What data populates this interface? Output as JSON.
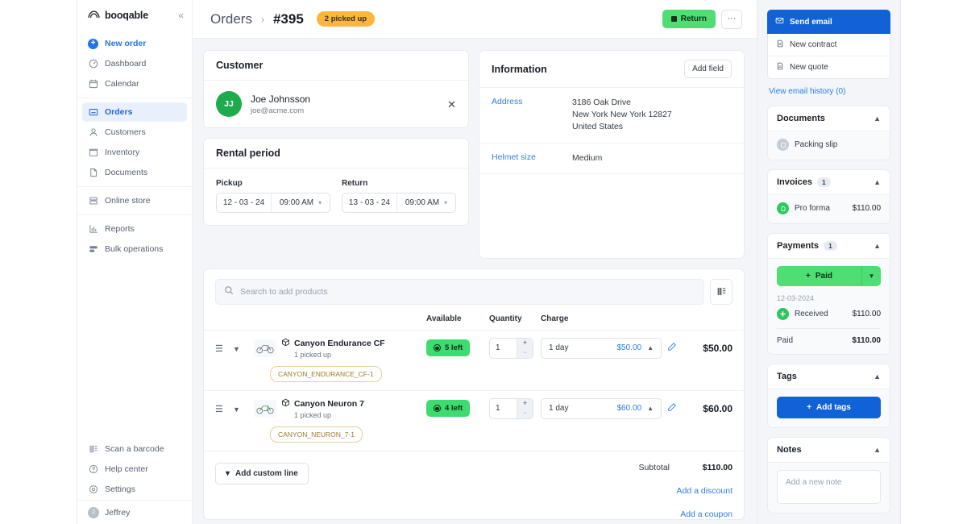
{
  "brand": {
    "name": "booqable",
    "collapse_icon": "chevrons-left-icon"
  },
  "sidebar": {
    "groups": [
      {
        "items": [
          {
            "label": "New order",
            "icon": "plus-circle-icon",
            "style": "primary"
          },
          {
            "label": "Dashboard",
            "icon": "dashboard-icon"
          },
          {
            "label": "Calendar",
            "icon": "calendar-icon"
          }
        ]
      },
      {
        "items": [
          {
            "label": "Orders",
            "icon": "orders-icon",
            "active": true
          },
          {
            "label": "Customers",
            "icon": "user-icon"
          },
          {
            "label": "Inventory",
            "icon": "inventory-icon"
          },
          {
            "label": "Documents",
            "icon": "document-icon"
          }
        ]
      },
      {
        "items": [
          {
            "label": "Online store",
            "icon": "store-icon"
          }
        ]
      },
      {
        "items": [
          {
            "label": "Reports",
            "icon": "reports-icon"
          },
          {
            "label": "Bulk operations",
            "icon": "bulk-operations-icon"
          }
        ]
      }
    ],
    "bottom_items": [
      {
        "label": "Scan a barcode",
        "icon": "barcode-icon"
      },
      {
        "label": "Help center",
        "icon": "help-circle-icon"
      },
      {
        "label": "Settings",
        "icon": "gear-icon"
      }
    ],
    "user": {
      "name": "Jeffrey",
      "initial": "J"
    }
  },
  "header": {
    "breadcrumb_parent": "Orders",
    "breadcrumb_sep": "›",
    "order_number": "#395",
    "status": "2 picked up",
    "return_label": "Return",
    "more_label": "···"
  },
  "customer": {
    "card_title": "Customer",
    "initials": "JJ",
    "name": "Joe Johnsson",
    "email": "joe@acme.com",
    "remove_icon": "close-icon"
  },
  "information": {
    "card_title": "Information",
    "add_field_label": "Add field",
    "rows": [
      {
        "label": "Address",
        "value": "3186 Oak Drive\nNew York New York 12827\nUnited States"
      },
      {
        "label": "Helmet size",
        "value": "Medium"
      }
    ]
  },
  "rental_period": {
    "card_title": "Rental period",
    "pickup": {
      "label": "Pickup",
      "date": "12 - 03 - 24",
      "time": "09:00 AM"
    },
    "return": {
      "label": "Return",
      "date": "13 - 03 - 24",
      "time": "09:00 AM"
    }
  },
  "products": {
    "search_placeholder": "Search to add products",
    "scan_icon": "barcode-scan-icon",
    "columns": {
      "available": "Available",
      "quantity": "Quantity",
      "charge": "Charge"
    },
    "rows": [
      {
        "name": "Canyon Endurance CF",
        "sub": "1 picked up",
        "available": "5 left",
        "quantity": "1",
        "charge_duration": "1 day",
        "charge_amount": "$50.00",
        "line_total": "$50.00",
        "tag": "CANYON_ENDURANCE_CF-1"
      },
      {
        "name": "Canyon Neuron 7",
        "sub": "1 picked up",
        "available": "4 left",
        "quantity": "1",
        "charge_duration": "1 day",
        "charge_amount": "$60.00",
        "line_total": "$60.00",
        "tag": "CANYON_NEURON_7-1"
      }
    ],
    "add_custom_line": "Add custom line",
    "subtotal_label": "Subtotal",
    "subtotal_value": "$110.00",
    "add_discount": "Add a discount",
    "add_coupon": "Add a coupon"
  },
  "right_panel": {
    "send_email": "Send email",
    "new_contract": "New contract",
    "new_quote": "New quote",
    "email_history": "View email history (0)",
    "documents": {
      "title": "Documents",
      "items": [
        {
          "label": "Packing slip"
        }
      ]
    },
    "invoices": {
      "title": "Invoices",
      "count": "1",
      "items": [
        {
          "label": "Pro forma",
          "amount": "$110.00"
        }
      ]
    },
    "payments": {
      "title": "Payments",
      "count": "1",
      "paid_button": "Paid",
      "date": "12-03-2024",
      "received_label": "Received",
      "received_amount": "$110.00",
      "paid_label": "Paid",
      "paid_amount": "$110.00"
    },
    "tags": {
      "title": "Tags",
      "add_label": "Add tags"
    },
    "notes": {
      "title": "Notes",
      "placeholder": "Add a new note"
    }
  },
  "colors": {
    "brand_blue": "#1062d6",
    "link_blue": "#2f7ce5",
    "green": "#4ede73",
    "avatar_green": "#1dab4e",
    "status_orange": "#fbb63b",
    "tag_border": "#e8cf9a"
  }
}
